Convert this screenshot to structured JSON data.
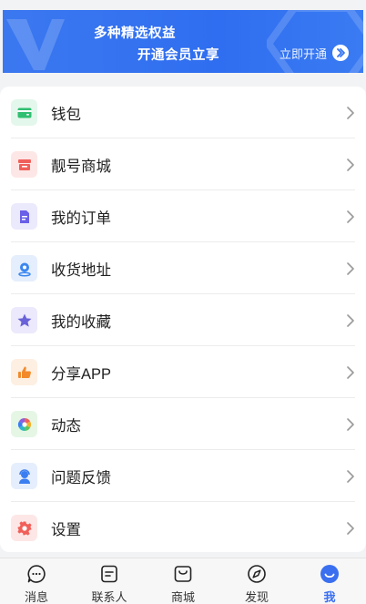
{
  "banner": {
    "line1": "多种精选权益",
    "line2": "开通会员立享",
    "open_label": "立即开通",
    "watermark_text": "VIP",
    "color": "#3574f0"
  },
  "menu": {
    "items": [
      {
        "label": "钱包",
        "icon": "wallet-icon",
        "icon_color": "#2fbf71",
        "icon_bg": "#e4f7ec"
      },
      {
        "label": "靓号商城",
        "icon": "store-icon",
        "icon_color": "#f0605a",
        "icon_bg": "#fde7e6"
      },
      {
        "label": "我的订单",
        "icon": "order-icon",
        "icon_color": "#6a5fe8",
        "icon_bg": "#ebe9fc"
      },
      {
        "label": "收货地址",
        "icon": "location-icon",
        "icon_color": "#3a86f0",
        "icon_bg": "#e5eefc"
      },
      {
        "label": "我的收藏",
        "icon": "star-icon",
        "icon_color": "#6a62d8",
        "icon_bg": "#ebe9fb"
      },
      {
        "label": "分享APP",
        "icon": "thumbs-up-icon",
        "icon_color": "#f28a2c",
        "icon_bg": "#fdefe1"
      },
      {
        "label": "动态",
        "icon": "aperture-icon",
        "icon_color": "#5cc85c",
        "icon_bg": "#e5f6e5"
      },
      {
        "label": "问题反馈",
        "icon": "support-agent-icon",
        "icon_color": "#3a7ef0",
        "icon_bg": "#e5eefc"
      },
      {
        "label": "设置",
        "icon": "gear-icon",
        "icon_color": "#f0605a",
        "icon_bg": "#fde7e6"
      }
    ]
  },
  "tabs": [
    {
      "label": "消息",
      "icon": "message-icon",
      "active": false
    },
    {
      "label": "联系人",
      "icon": "contacts-icon",
      "active": false
    },
    {
      "label": "商城",
      "icon": "bag-icon",
      "active": false
    },
    {
      "label": "发现",
      "icon": "compass-icon",
      "active": false
    },
    {
      "label": "我",
      "icon": "me-icon",
      "active": true
    }
  ],
  "colors": {
    "accent": "#3a6ff0",
    "chevron": "#9a9a9a",
    "background": "#f2f3f5"
  }
}
